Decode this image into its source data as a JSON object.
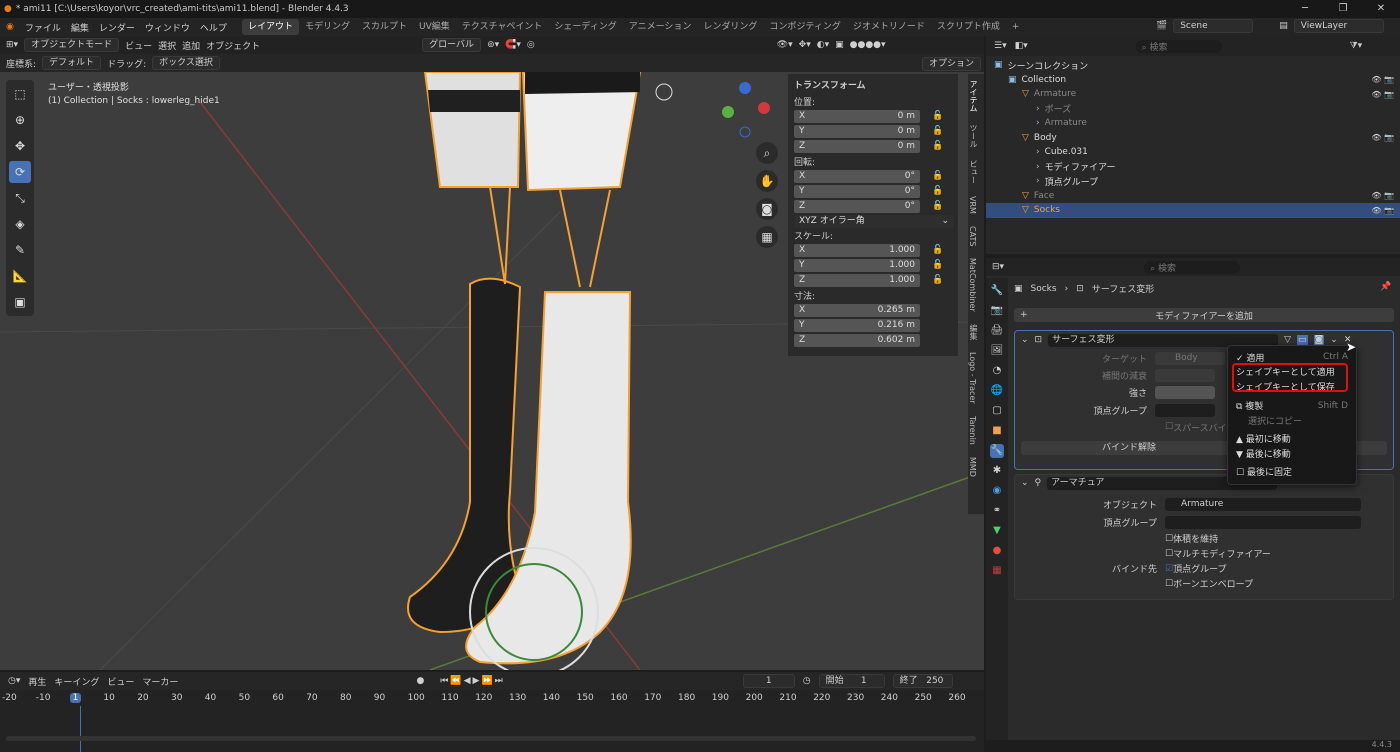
{
  "window": {
    "title": "* ami11 [C:\\Users\\koyor\\vrc_created\\ami-tits\\ami11.blend] - Blender 4.4.3",
    "minimize": "─",
    "maximize": "❐",
    "close": "✕"
  },
  "menu": {
    "items": [
      "ファイル",
      "編集",
      "レンダー",
      "ウィンドウ",
      "ヘルプ"
    ],
    "workspaces": [
      "レイアウト",
      "モデリング",
      "スカルプト",
      "UV編集",
      "テクスチャペイント",
      "シェーディング",
      "アニメーション",
      "レンダリング",
      "コンポジティング",
      "ジオメトリノード",
      "スクリプト作成"
    ],
    "add_ws": "+",
    "scene": "Scene",
    "view_layer": "ViewLayer"
  },
  "viewport": {
    "mode": "オブジェクトモード",
    "view": "ビュー",
    "select": "選択",
    "add": "追加",
    "object": "オブジェクト",
    "orientation": "グローバル",
    "coords_label": "座標系:",
    "coords_value": "デフォルト",
    "drag_label": "ドラッグ:",
    "drag_value": "ボックス選択",
    "options": "オプション",
    "overlay_title": "ユーザー・透視投影",
    "overlay_sub": "(1) Collection | Socks : lowerleg_hide1"
  },
  "npanel": {
    "header": "トランスフォーム",
    "location": "位置:",
    "loc": [
      {
        "a": "X",
        "v": "0 m"
      },
      {
        "a": "Y",
        "v": "0 m"
      },
      {
        "a": "Z",
        "v": "0 m"
      }
    ],
    "rotation": "回転:",
    "rot": [
      {
        "a": "X",
        "v": "0°"
      },
      {
        "a": "Y",
        "v": "0°"
      },
      {
        "a": "Z",
        "v": "0°"
      }
    ],
    "rot_mode": "XYZ オイラー角",
    "scale": "スケール:",
    "scl": [
      {
        "a": "X",
        "v": "1.000"
      },
      {
        "a": "Y",
        "v": "1.000"
      },
      {
        "a": "Z",
        "v": "1.000"
      }
    ],
    "dims": "寸法:",
    "dim": [
      {
        "a": "X",
        "v": "0.265 m"
      },
      {
        "a": "Y",
        "v": "0.216 m"
      },
      {
        "a": "Z",
        "v": "0.602 m"
      }
    ],
    "tabs": [
      "アイテム",
      "ツール",
      "ビュー",
      "VRM",
      "CATS",
      "MatCombiner",
      "編集",
      "Logo - Tracer",
      "Tarenin",
      "MMD"
    ]
  },
  "outliner": {
    "search": "検索",
    "rows": [
      {
        "label": "シーンコレクション",
        "indent": 0,
        "color": "#ddd"
      },
      {
        "label": "Collection",
        "indent": 1,
        "color": "#ddd"
      },
      {
        "label": "Armature",
        "indent": 2,
        "color": "#888"
      },
      {
        "label": "ポーズ",
        "indent": 3,
        "color": "#888"
      },
      {
        "label": "Armature",
        "indent": 3,
        "color": "#888"
      },
      {
        "label": "Body",
        "indent": 2,
        "color": "#ddd"
      },
      {
        "label": "Cube.031",
        "indent": 3,
        "color": "#ddd"
      },
      {
        "label": "モディファイアー",
        "indent": 3,
        "color": "#ddd"
      },
      {
        "label": "頂点グループ",
        "indent": 3,
        "color": "#ddd"
      },
      {
        "label": "Face",
        "indent": 2,
        "color": "#888"
      },
      {
        "label": "Socks",
        "indent": 2,
        "color": "#f0a050",
        "selected": true
      }
    ]
  },
  "properties": {
    "search": "検索",
    "breadcrumb_obj": "Socks",
    "breadcrumb_mod": "サーフェス変形",
    "add_modifier": "モディファイアーを追加",
    "mod1": {
      "name": "サーフェス変形",
      "target_label": "ターゲット",
      "target": "Body",
      "falloff": "補間の減衰",
      "strength": "強さ",
      "vgroup": "頂点グループ",
      "sparse": "スパースバイ",
      "unbind": "バインド解除"
    },
    "mod2": {
      "name": "アーマチュア",
      "object_label": "オブジェクト",
      "object": "Armature",
      "vgroup_label": "頂点グループ",
      "preserve": "体積を維持",
      "multi": "マルチモディファイアー",
      "bind_to": "バインド先",
      "bind_vg": "頂点グループ",
      "bind_env": "ボーンエンベロープ"
    }
  },
  "context_menu": {
    "apply": "適用",
    "apply_sc": "Ctrl A",
    "apply_shape": "シェイプキーとして適用",
    "save_shape": "シェイプキーとして保存",
    "duplicate": "複製",
    "duplicate_sc": "Shift D",
    "copy_sel": "選択にコピー",
    "move_first": "最初に移動",
    "move_last": "最後に移動",
    "pin_last": "最後に固定"
  },
  "timeline": {
    "play": "再生",
    "keying": "キーイング",
    "view": "ビュー",
    "marker": "マーカー",
    "current": "1",
    "start_label": "開始",
    "start": "1",
    "end_label": "終了",
    "end": "250",
    "ticks": [
      "-20",
      "-10",
      "1",
      "10",
      "20",
      "30",
      "40",
      "50",
      "60",
      "70",
      "80",
      "90",
      "100",
      "110",
      "120",
      "130",
      "140",
      "150",
      "160",
      "170",
      "180",
      "190",
      "200",
      "210",
      "220",
      "230",
      "240",
      "250",
      "260"
    ]
  },
  "version": "4.4.3",
  "colors": {
    "accent": "#4772b3",
    "orange": "#f0a050",
    "highlight_red": "#e01010"
  }
}
